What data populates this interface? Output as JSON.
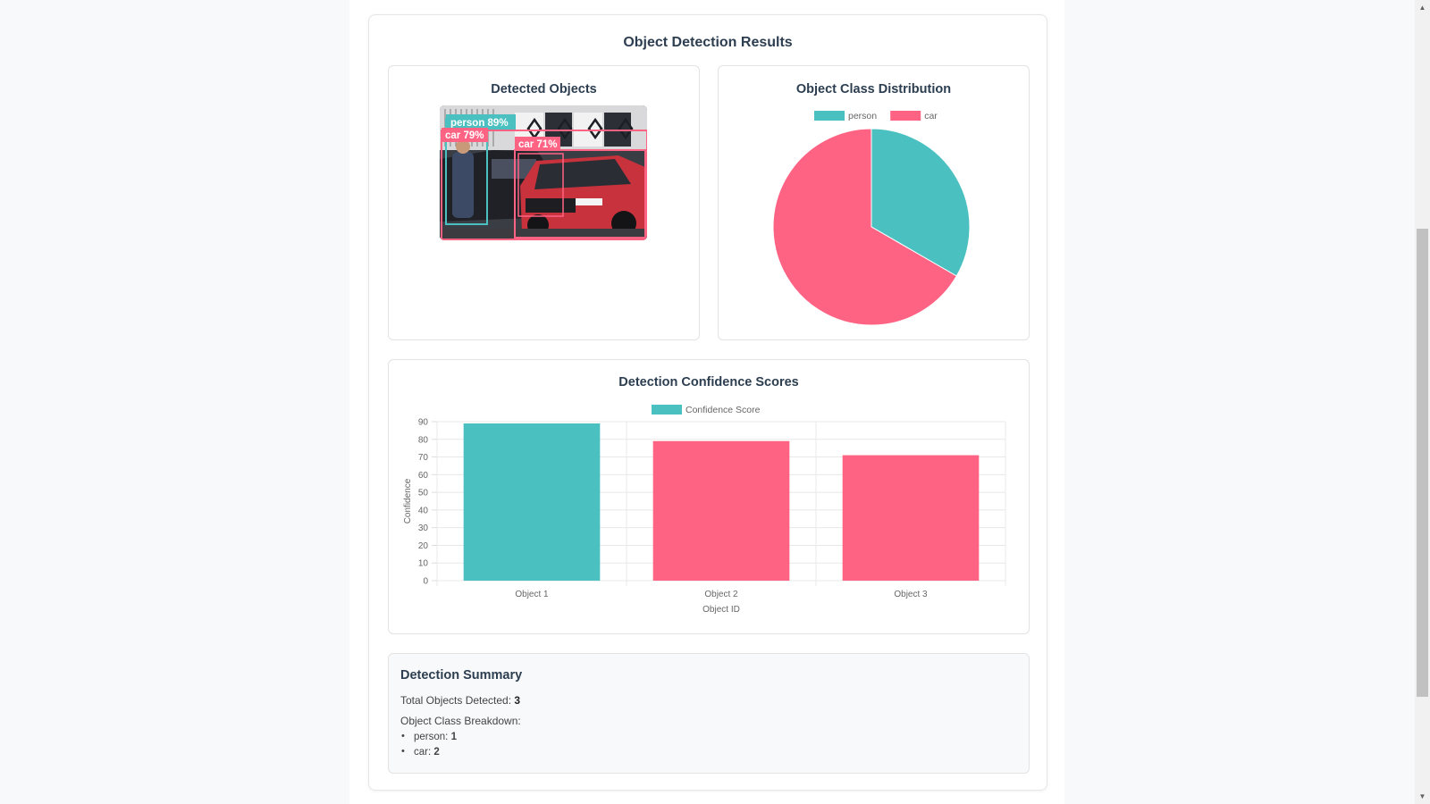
{
  "page": {
    "title": "Object Detection Results"
  },
  "detected_panel": {
    "title": "Detected Objects",
    "detections": [
      {
        "label": "person 89%",
        "color": "#4bc0c0"
      },
      {
        "label": "car 79%",
        "color": "#ff6384"
      },
      {
        "label": "car 71%",
        "color": "#ff6384"
      }
    ]
  },
  "colors": {
    "person": "#4bc0c0",
    "car": "#ff6384"
  },
  "chart_data": [
    {
      "type": "pie",
      "title": "Object Class Distribution",
      "labels": [
        "person",
        "car"
      ],
      "values": [
        1,
        2
      ],
      "colors": [
        "#4bc0c0",
        "#ff6384"
      ],
      "legend": "top"
    },
    {
      "type": "bar",
      "title": "Detection Confidence Scores",
      "categories": [
        "Object 1",
        "Object 2",
        "Object 3"
      ],
      "series": [
        {
          "name": "Confidence Score",
          "values": [
            89,
            79,
            71
          ]
        }
      ],
      "bar_colors": [
        "#4bc0c0",
        "#ff6384",
        "#ff6384"
      ],
      "xlabel": "Object ID",
      "ylabel": "Confidence",
      "ylim": [
        0,
        90
      ],
      "yticks": [
        "90",
        "80",
        "70",
        "60",
        "50",
        "40",
        "30",
        "20",
        "10",
        "0"
      ],
      "grid": true,
      "legend": "top"
    }
  ],
  "summary": {
    "title": "Detection Summary",
    "total_label": "Total Objects Detected:",
    "total_value": "3",
    "breakdown_label": "Object Class Breakdown:",
    "items": [
      {
        "label": "person:",
        "value": "1"
      },
      {
        "label": "car:",
        "value": "2"
      }
    ]
  },
  "scrollbar": {
    "up_icon": "triangle-up-icon",
    "down_icon": "triangle-down-icon"
  }
}
